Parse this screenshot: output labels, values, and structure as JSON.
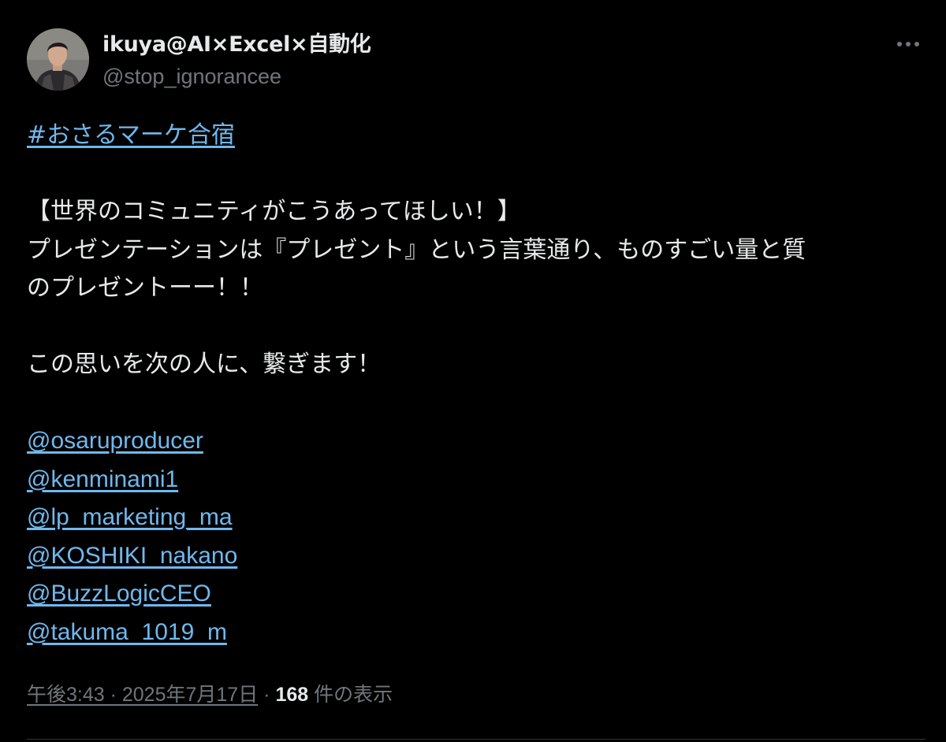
{
  "author": {
    "display_name": "ikuya@AI×Excel×自動化",
    "handle": "@stop_ignorancee"
  },
  "tweet": {
    "hashtag": "#おさるマーケ合宿",
    "lines": [
      "【世界のコミュニティがこうあってほしい！】",
      "プレゼンテーションは『プレゼント』という言葉通り、ものすごい量と質",
      "のプレゼントーー！！",
      "この思いを次の人に、繋ぎます！"
    ],
    "mentions": [
      "@osaruproducer",
      "@kenminami1",
      "@lp_marketing_ma",
      "@KOSHIKI_nakano",
      "@BuzzLogicCEO",
      "@takuma_1019_m"
    ]
  },
  "meta": {
    "timestamp": "午後3:43 · 2025年7月17日",
    "separator": "·",
    "views_count": "168",
    "views_label": "件の表示"
  },
  "icons": {
    "more": "more-horizontal-icon"
  },
  "colors": {
    "background": "#000000",
    "text": "#e7e9ea",
    "secondary": "#71767b",
    "link": "#6fb8ee",
    "divider": "#2f3336"
  }
}
